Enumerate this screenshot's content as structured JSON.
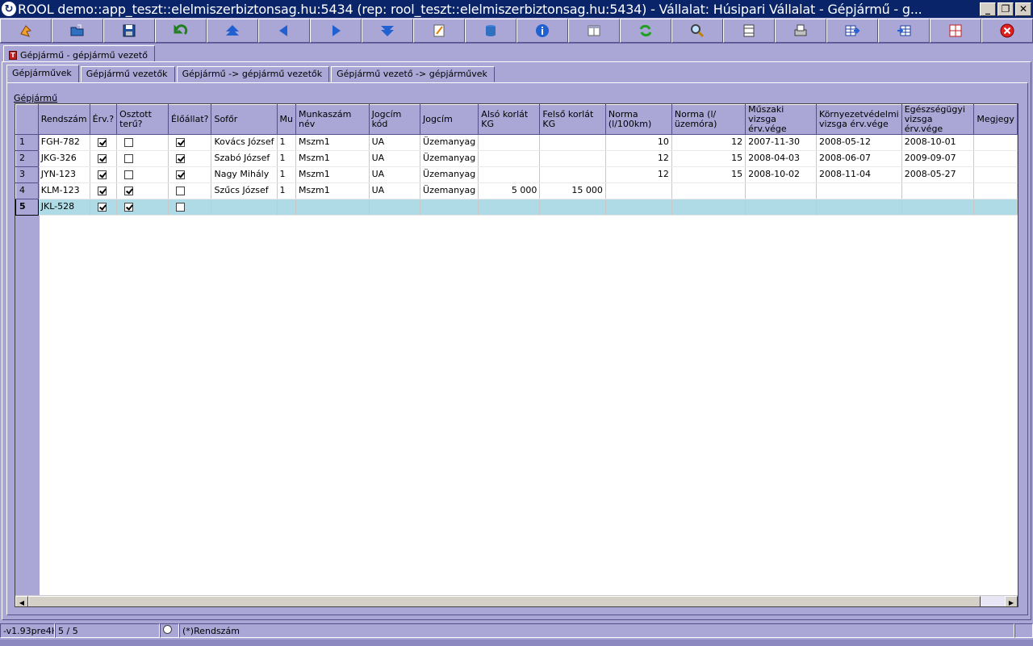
{
  "window": {
    "title": "ROOL demo::app_teszt::elelmiszerbiztonsag.hu:5434 (rep: rool_teszt::elelmiszerbiztonsag.hu:5434) - Vállalat: Húsipari Vállalat - Gépjármű - g...",
    "minimize": "_",
    "restore": "❐",
    "close": "✕"
  },
  "toolbar": {
    "buttons": [
      "run-icon",
      "open-folder-icon",
      "save-icon",
      "undo-icon",
      "first-record-icon",
      "previous-icon",
      "next-icon",
      "last-record-icon",
      "edit-icon",
      "database-icon",
      "info-icon",
      "form-view-icon",
      "refresh-icon",
      "search-icon",
      "column-icon",
      "print-icon",
      "grid-export-icon",
      "grid-import-icon",
      "fit-window-icon",
      "close-red-icon"
    ]
  },
  "outer_tab": {
    "label": "Gépjármű - gépjármű vezető",
    "icon": "T"
  },
  "inner_tabs": [
    "Gépjárművek",
    "Gépjármű vezetők",
    "Gépjármű -> gépjármű vezetők",
    "Gépjármű vezető -> gépjárművek"
  ],
  "group_label": "Gépjármű",
  "grid": {
    "columns": [
      "Rendszám",
      "Érv.?",
      "Osztott terű?",
      "Élőállat?",
      "Sofőr",
      "Mu",
      "Munkaszám név",
      "Jogcím kód",
      "Jogcím",
      "Alsó korlát KG",
      "Felső korlát KG",
      "Norma (l/100km)",
      "Norma (l/üzemóra)",
      "Műszaki vizsga érv.vége",
      "Környezetvédelmi vizsga érv.vége",
      "Egészségügyi vizsga érv.vége",
      "Megjegy"
    ],
    "rows": [
      {
        "n": "1",
        "rendszam": "FGH-782",
        "erv": true,
        "osztott": false,
        "eloallat": true,
        "sofor": "Kovács József",
        "mu": "1",
        "munkaszam": "Mszm1",
        "jogcim_kod": "UA",
        "jogcim": "Üzemanyag",
        "also": "",
        "felso": "",
        "norma_km": "10",
        "norma_ora": "12",
        "muszaki": "2007-11-30",
        "kornyezet": "2008-05-12",
        "egeszseg": "2008-10-01"
      },
      {
        "n": "2",
        "rendszam": "JKG-326",
        "erv": true,
        "osztott": false,
        "eloallat": true,
        "sofor": "Szabó József",
        "mu": "1",
        "munkaszam": "Mszm1",
        "jogcim_kod": "UA",
        "jogcim": "Üzemanyag",
        "also": "",
        "felso": "",
        "norma_km": "12",
        "norma_ora": "15",
        "muszaki": "2008-04-03",
        "kornyezet": "2008-06-07",
        "egeszseg": "2009-09-07"
      },
      {
        "n": "3",
        "rendszam": "JYN-123",
        "erv": true,
        "osztott": false,
        "eloallat": true,
        "sofor": "Nagy Mihály",
        "mu": "1",
        "munkaszam": "Mszm1",
        "jogcim_kod": "UA",
        "jogcim": "Üzemanyag",
        "also": "",
        "felso": "",
        "norma_km": "12",
        "norma_ora": "15",
        "muszaki": "2008-10-02",
        "kornyezet": "2008-11-04",
        "egeszseg": "2008-05-27"
      },
      {
        "n": "4",
        "rendszam": "KLM-123",
        "erv": true,
        "osztott": true,
        "eloallat": false,
        "sofor": "Szűcs József",
        "mu": "1",
        "munkaszam": "Mszm1",
        "jogcim_kod": "UA",
        "jogcim": "Üzemanyag",
        "also": "5 000",
        "felso": "15 000",
        "norma_km": "",
        "norma_ora": "",
        "muszaki": "",
        "kornyezet": "",
        "egeszseg": ""
      },
      {
        "n": "5",
        "rendszam": "JKL-528",
        "erv": true,
        "osztott": true,
        "eloallat": false,
        "sofor": "",
        "mu": "",
        "munkaszam": "",
        "jogcim_kod": "",
        "jogcim": "",
        "also": "",
        "felso": "",
        "norma_km": "",
        "norma_ora": "",
        "muszaki": "",
        "kornyezet": "",
        "egeszseg": "",
        "selected": true
      }
    ]
  },
  "statusbar": {
    "version": "-v1.93pre4H",
    "record": "5 / 5",
    "sort": "(*)Rendszám"
  },
  "colors": {
    "background": "#aaa6d6",
    "titlebar": "#0a246a",
    "selected_row": "#aedbe6"
  }
}
